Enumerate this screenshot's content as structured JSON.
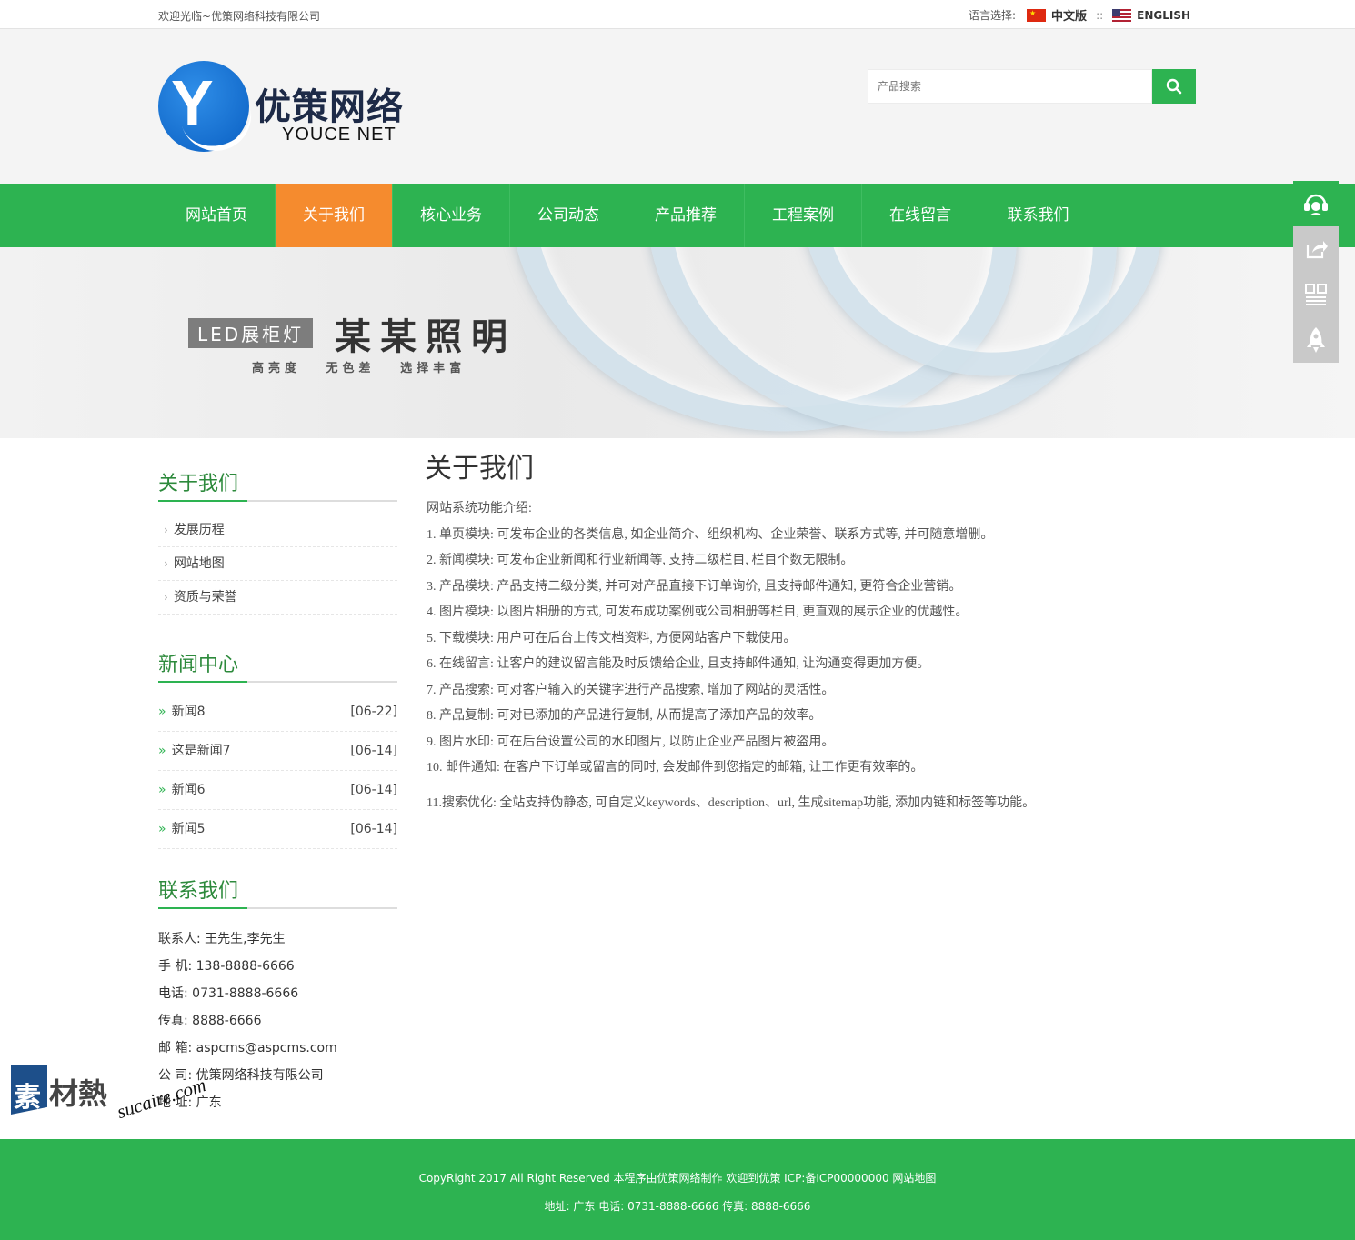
{
  "topbar": {
    "welcome": "欢迎光临~优策网络科技有限公司",
    "lang_label": "语言选择:",
    "cn_label": "中文版",
    "separator": "::",
    "en_label": "ENGLISH"
  },
  "logo": {
    "cn_name": "优策网络",
    "en_name": "YOUCE NET"
  },
  "search": {
    "placeholder": "产品搜索"
  },
  "nav": {
    "items": [
      "网站首页",
      "关于我们",
      "核心业务",
      "公司动态",
      "产品推荐",
      "工程案例",
      "在线留言",
      "联系我们"
    ],
    "active_index": 1
  },
  "banner": {
    "tag": "LED展柜灯",
    "brand": "某某照明",
    "sub1": "高亮度",
    "sub2": "无色差",
    "sub3": "选择丰富"
  },
  "float_bar": {
    "icons": [
      "headset-icon",
      "share-icon",
      "qrcode-icon",
      "rocket-icon"
    ]
  },
  "sidebar": {
    "about": {
      "title": "关于我们",
      "items": [
        "发展历程",
        "网站地图",
        "资质与荣誉"
      ]
    },
    "news": {
      "title": "新闻中心",
      "items": [
        {
          "title": "新闻8",
          "date": "[06-22]"
        },
        {
          "title": "这是新闻7",
          "date": "[06-14]"
        },
        {
          "title": "新闻6",
          "date": "[06-14]"
        },
        {
          "title": "新闻5",
          "date": "[06-14]"
        }
      ]
    },
    "contact": {
      "title": "联系我们",
      "lines": [
        "联系人: 王先生,李先生",
        "手 机: 138-8888-6666",
        "电话: 0731-8888-6666",
        "传真: 8888-6666",
        "邮 箱: aspcms@aspcms.com",
        "公 司: 优策网络科技有限公司",
        "地 址: 广东"
      ]
    }
  },
  "main": {
    "title": "关于我们",
    "intro": "网站系统功能介绍:",
    "paragraphs": [
      "1. 单页模块: 可发布企业的各类信息, 如企业简介、组织机构、企业荣誉、联系方式等, 并可随意增删。",
      "2. 新闻模块: 可发布企业新闻和行业新闻等, 支持二级栏目, 栏目个数无限制。",
      "3. 产品模块: 产品支持二级分类, 并可对产品直接下订单询价, 且支持邮件通知, 更符合企业营销。",
      "4. 图片模块: 以图片相册的方式, 可发布成功案例或公司相册等栏目, 更直观的展示企业的优越性。",
      "5. 下载模块: 用户可在后台上传文档资料, 方便网站客户下载使用。",
      "6. 在线留言: 让客户的建议留言能及时反馈给企业, 且支持邮件通知, 让沟通变得更加方便。",
      "7. 产品搜索: 可对客户输入的关键字进行产品搜索, 增加了网站的灵活性。",
      "8. 产品复制: 可对已添加的产品进行复制, 从而提高了添加产品的效率。",
      "9. 图片水印: 可在后台设置公司的水印图片, 以防止企业产品图片被盗用。",
      "10. 邮件通知: 在客户下订单或留言的同时, 会发邮件到您指定的邮箱, 让工作更有效率的。",
      "11.搜索优化: 全站支持伪静态, 可自定义keywords、description、url, 生成sitemap功能, 添加内链和标签等功能。"
    ]
  },
  "watermark": {
    "mark": "素",
    "cn": "材熱",
    "en": "sucaire.com"
  },
  "footer": {
    "line1": "CopyRight 2017 All Right Reserved 本程序由优策网络制作 欢迎到优策  ICP:备ICP00000000 网站地图",
    "line2": "地址: 广东  电话: 0731-8888-6666  传真: 8888-6666"
  },
  "colors": {
    "primary_green": "#2db351",
    "active_orange": "#f58b2e",
    "logo_blue": "#0a5fc2"
  }
}
